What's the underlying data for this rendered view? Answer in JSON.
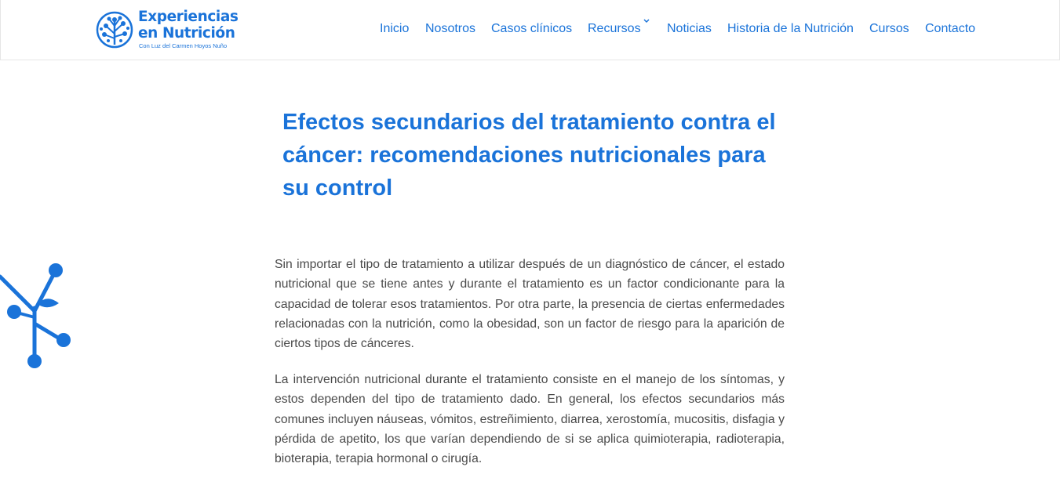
{
  "header": {
    "logo": {
      "line1": "Experiencias",
      "line2": "en Nutrición",
      "subtitle": "Con Luz del Carmen Hoyos Nuño"
    },
    "nav": {
      "inicio": "Inicio",
      "nosotros": "Nosotros",
      "casos": "Casos clínicos",
      "recursos": "Recursos",
      "noticias": "Noticias",
      "historia": "Historia de la Nutrición",
      "cursos": "Cursos",
      "contacto": "Contacto"
    }
  },
  "article": {
    "title": "Efectos secundarios del tratamiento contra el cáncer: recomendaciones nutricionales para su control",
    "paragraphs": [
      "Sin importar el tipo de tratamiento a utilizar después de un diagnóstico de cáncer, el estado nutricional que se tiene antes y durante el tratamiento es un factor condicionante para la capacidad de tolerar esos tratamientos. Por otra parte, la presencia de ciertas enfermedades relacionadas con la nutrición, como la obesidad, son un factor de riesgo para la aparición de ciertos tipos de cánceres.",
      "La intervención nutricional durante el tratamiento consiste en el manejo de los síntomas, y estos dependen del tipo de tratamiento dado. En general, los efectos secundarios más comunes incluyen náuseas, vómitos, estreñimiento, diarrea, xerostomía, mucositis, disfagia y pérdida de apetito, los que varían dependiendo de si se aplica quimioterapia, radioterapia, bioterapia, terapia hormonal o cirugía."
    ]
  },
  "icons": {
    "logo": "tree-network-logo-icon",
    "dropdown": "chevron-down-icon",
    "decoration": "branch-network-icon"
  },
  "colors": {
    "brand_blue": "#1a73d9",
    "body_text": "#4a4a4a",
    "border": "#e6e6e6"
  }
}
